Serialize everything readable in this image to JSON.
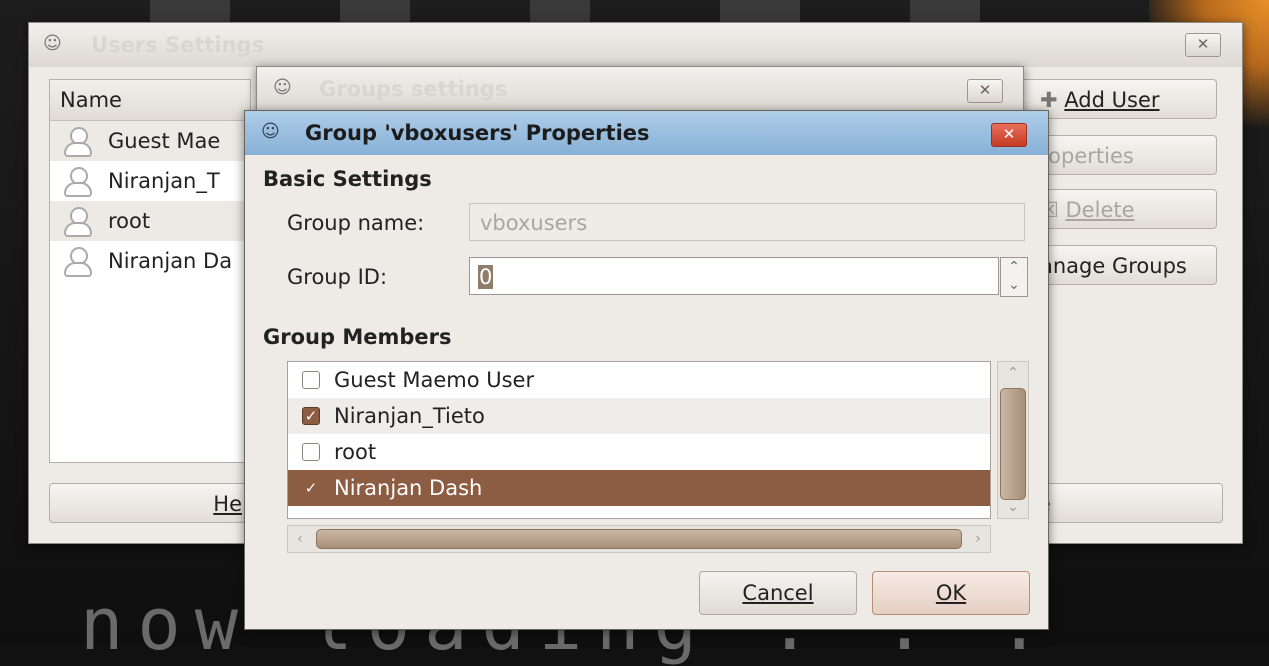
{
  "background": {
    "text": "now loading . . ."
  },
  "users_window": {
    "title": "Users Settings",
    "list_header": "Name",
    "users": [
      {
        "name": "Guest Mae",
        "icon": "user-icon"
      },
      {
        "name": "Niranjan_T",
        "icon": "user-icon"
      },
      {
        "name": "root",
        "icon": "user-icon"
      },
      {
        "name": "Niranjan Da",
        "icon": "user-icon"
      }
    ],
    "add_user_label": "Add User",
    "properties_label": "roperties",
    "delete_label": "Delete",
    "manage_groups_label": "anage Groups",
    "help_label": "He",
    "close_label": "e"
  },
  "groups_window": {
    "title": "Groups settings"
  },
  "props_dialog": {
    "title": "Group 'vboxusers' Properties",
    "basic_settings": "Basic Settings",
    "group_name_label": "Group name:",
    "group_name_value": "vboxusers",
    "group_id_label": "Group ID:",
    "group_id_value": "0",
    "group_members": "Group Members",
    "members": [
      {
        "name": "Guest Maemo User",
        "checked": false
      },
      {
        "name": "Niranjan_Tieto",
        "checked": true
      },
      {
        "name": "root",
        "checked": false
      },
      {
        "name": "Niranjan Dash",
        "checked": true,
        "selected": true
      }
    ],
    "cancel_label": "Cancel",
    "ok_label": "OK"
  },
  "colors": {
    "accent": "#8c5d43",
    "dialog_title": "#87b0d6",
    "close_red": "#c53b24"
  }
}
